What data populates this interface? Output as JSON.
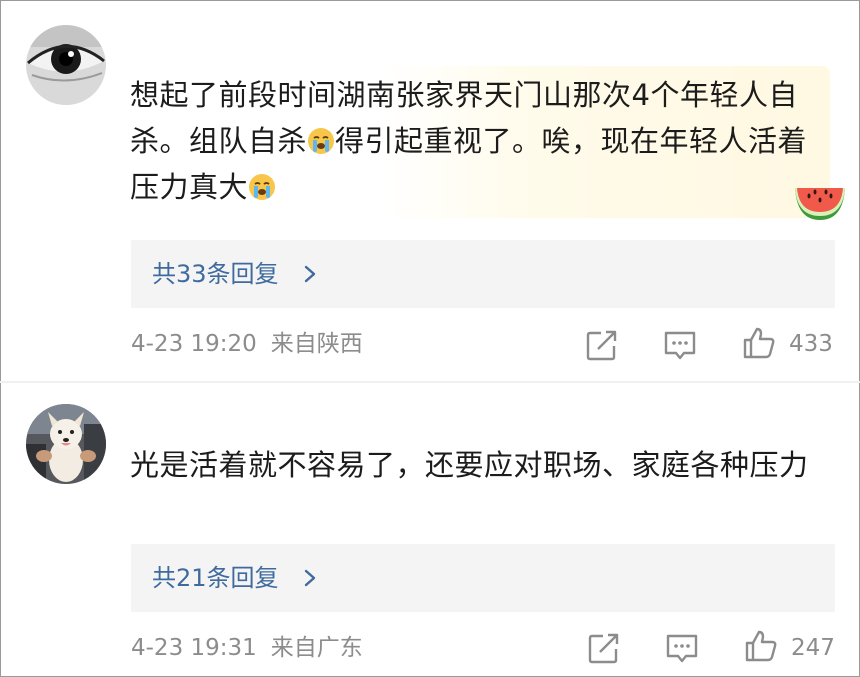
{
  "comments": [
    {
      "avatar": "eye-closeup-avatar",
      "text_segments": [
        "想起了前段时间湖南张家界天门山那次4个年轻人自杀。组队自杀",
        "得引起重视了。唉，现在年轻人活着压力真大"
      ],
      "inline_emoji": "crying-face-icon",
      "sticker": "watermelon-sticker",
      "replies_label": "共33条回复",
      "time": "4-23 19:20",
      "location": "来自陕西",
      "likes": "433"
    },
    {
      "avatar": "dog-photo-avatar",
      "text": "光是活着就不容易了，还要应对职场、家庭各种压力",
      "replies_label": "共21条回复",
      "time": "4-23 19:31",
      "location": "来自广东",
      "likes": "247"
    }
  ],
  "icons": {
    "share": "share-icon",
    "comment": "comment-icon",
    "like": "thumbs-up-icon",
    "chevron": "chevron-right-icon"
  },
  "colors": {
    "reply_link": "#3f6a9e",
    "meta_text": "#8c8c8c",
    "reply_box_bg": "#f4f4f4",
    "highlight_bg": "#fff8e2"
  }
}
